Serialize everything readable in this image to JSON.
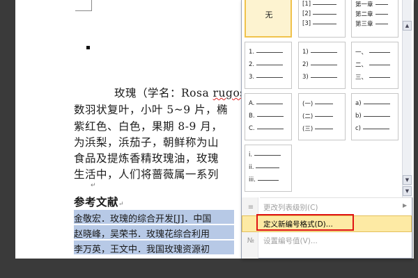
{
  "document": {
    "para_line1_start": "玫瑰（学名：Rosa ",
    "para_line1_misspelled": "rugos",
    "para_line2": "数羽状复叶，小叶 5~9 片，椭",
    "para_line3": "紫红色、白色，果期 8-9 月，",
    "para_line4": "为浜梨，浜茄子，朝鲜称为山",
    "para_line5": "食品及提炼香精玫瑰油，玫瑰",
    "para_line6": "生活中，人们将蔷薇属一系列",
    "para_mark": "↵",
    "references_heading": "参考文献",
    "ref_mark": "↵",
    "ref1": "金敬宏．玫瑰的综合开发[J]．中国",
    "ref2": "赵晓峰，吴荣书．玫瑰花综合利用",
    "ref3": "李万英，王文中．我国玫瑰资源初"
  },
  "numbering_gallery": {
    "none_label": "无",
    "styles": [
      {
        "items": [
          "[1]",
          "[2]",
          "[3]"
        ]
      },
      {
        "items": [
          "第一章",
          "第二章",
          "第三章"
        ]
      },
      {
        "items": [
          "1.",
          "2.",
          "3."
        ]
      },
      {
        "items": [
          "1)",
          "2)",
          "3)"
        ]
      },
      {
        "items": [
          "一、",
          "二、",
          "三、"
        ]
      },
      {
        "items": [
          "A.",
          "B.",
          "C."
        ]
      },
      {
        "items": [
          "(一)",
          "(二)",
          "(三)"
        ]
      },
      {
        "items": [
          "a)",
          "b)",
          "c)"
        ]
      },
      {
        "items": [
          "i.",
          "ii.",
          "iii."
        ]
      }
    ]
  },
  "menu": {
    "change_level_label": "更改列表级别(C)",
    "define_format_label": "定义新编号格式(D)...",
    "set_value_label": "设置编号值(V)..."
  },
  "colors": {
    "highlight": "#b7c9e6",
    "hover": "#fdeaa4",
    "annotation_box": "#e01313"
  }
}
